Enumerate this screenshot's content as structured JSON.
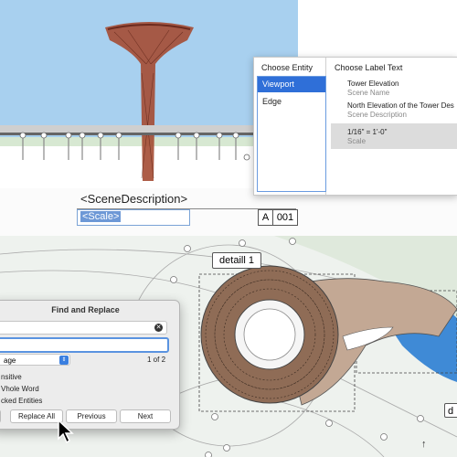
{
  "drawing": {
    "scene_description": "<SceneDescription>",
    "scale_placeholder": "<Scale>",
    "label_cell_a": "A",
    "label_cell_num": "001",
    "detail_tag": "detaill 1",
    "detail_tag_2": "d"
  },
  "label_chooser": {
    "entity_header": "Choose Entity",
    "text_header": "Choose Label Text",
    "entities": [
      "Viewport",
      "Edge"
    ],
    "selected_entity": "Viewport",
    "options": [
      {
        "value": "Tower Elevation",
        "field": "Scene Name"
      },
      {
        "value": "North Elevation of the Tower Des",
        "field": "Scene Description"
      },
      {
        "value": "1/16\" = 1'-0\"",
        "field": "Scale"
      }
    ]
  },
  "find_replace": {
    "title": "Find and Replace",
    "scope": "age",
    "match_count": "1 of 2",
    "options": [
      "nsitive",
      "Vhole Word",
      "cked Entities"
    ],
    "buttons": {
      "replace_all": "Replace All",
      "previous": "Previous",
      "next": "Next"
    }
  },
  "colors": {
    "accent": "#2f6fd8",
    "sky": "#a8d0ef",
    "tower_wood": "#8b3a2a",
    "plan_fill": "#c3a894"
  },
  "icons": {
    "clear": "clear-circle-x-icon",
    "caret": "stepper-caret-icon",
    "cursor": "arrow-cursor-icon"
  }
}
